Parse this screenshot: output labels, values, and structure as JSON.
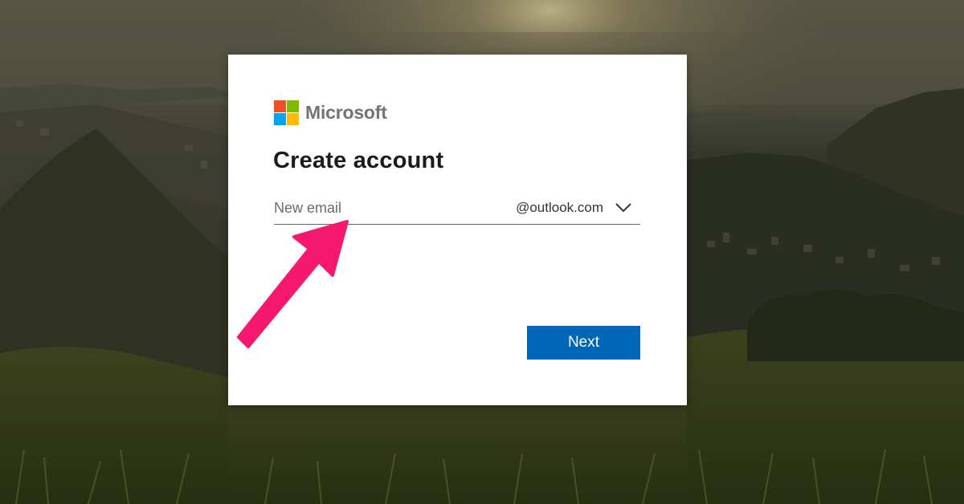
{
  "brand": {
    "name": "Microsoft",
    "logo_colors": [
      "#f25022",
      "#7fba00",
      "#00a4ef",
      "#ffb900"
    ]
  },
  "dialog": {
    "title": "Create account"
  },
  "email": {
    "placeholder": "New email",
    "value": "",
    "domain": "@outlook.com",
    "domain_icon": "chevron-down-icon"
  },
  "actions": {
    "next_label": "Next",
    "accent_color": "#0067b8"
  },
  "annotation": {
    "icon": "pink-arrow-icon",
    "color": "#f5186e"
  }
}
